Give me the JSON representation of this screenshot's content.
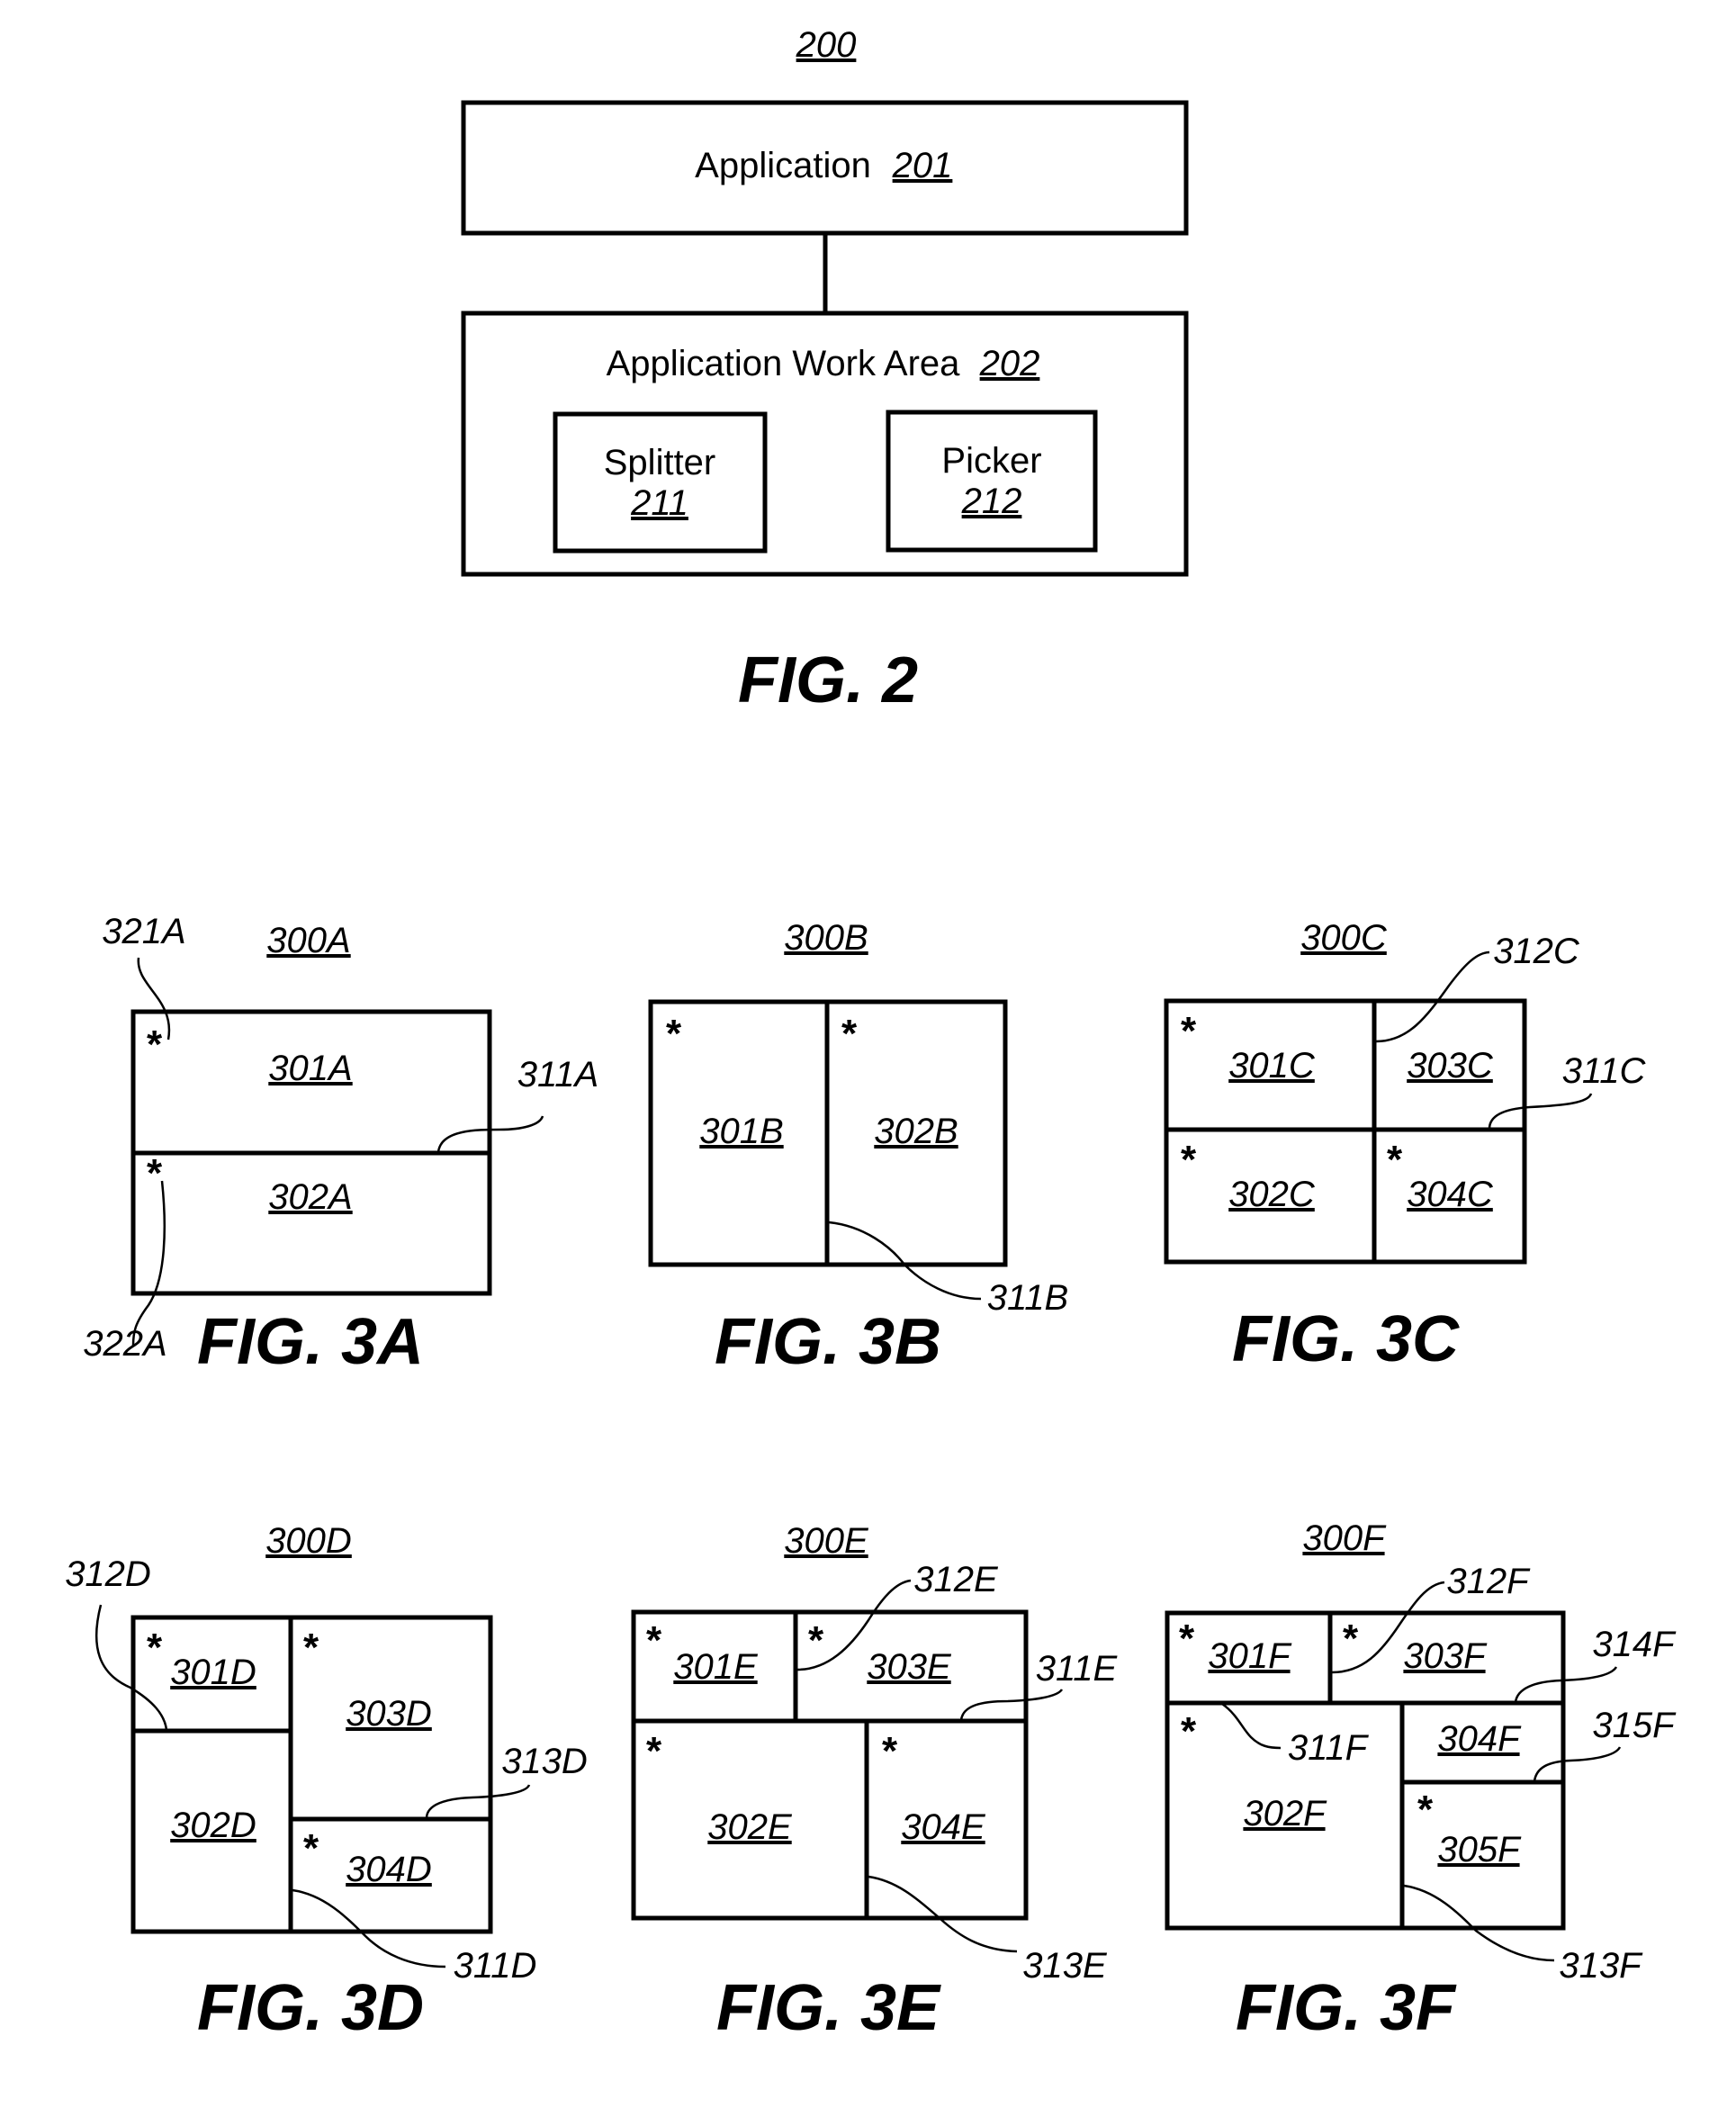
{
  "fig2": {
    "ref": "200",
    "application": {
      "label": "Application",
      "ref": "201"
    },
    "work_area": {
      "label": "Application Work Area",
      "ref": "202"
    },
    "splitter": {
      "label": "Splitter",
      "ref": "211"
    },
    "picker": {
      "label": "Picker",
      "ref": "212"
    },
    "caption": "FIG.  2"
  },
  "fig3a": {
    "ref": "300A",
    "caption": "FIG.  3A",
    "panes": [
      "301A",
      "302A"
    ],
    "splitters": [
      "311A"
    ],
    "markers": [
      "321A",
      "322A"
    ],
    "marker_symbol": "*"
  },
  "fig3b": {
    "ref": "300B",
    "caption": "FIG.  3B",
    "panes": [
      "301B",
      "302B"
    ],
    "splitters": [
      "311B"
    ],
    "marker_symbol": "*"
  },
  "fig3c": {
    "ref": "300C",
    "caption": "FIG.  3C",
    "panes": [
      "301C",
      "302C",
      "303C",
      "304C"
    ],
    "splitters": [
      "311C",
      "312C"
    ],
    "marker_symbol": "*"
  },
  "fig3d": {
    "ref": "300D",
    "caption": "FIG.  3D",
    "panes": [
      "301D",
      "302D",
      "303D",
      "304D"
    ],
    "splitters": [
      "311D",
      "312D",
      "313D"
    ],
    "marker_symbol": "*"
  },
  "fig3e": {
    "ref": "300E",
    "caption": "FIG.  3E",
    "panes": [
      "301E",
      "302E",
      "303E",
      "304E"
    ],
    "splitters": [
      "311E",
      "312E",
      "313E"
    ],
    "marker_symbol": "*"
  },
  "fig3f": {
    "ref": "300F",
    "caption": "FIG.  3F",
    "panes": [
      "301F",
      "302F",
      "303F",
      "304F",
      "305F"
    ],
    "splitters": [
      "311F",
      "312F",
      "313F",
      "314F",
      "315F"
    ],
    "marker_symbol": "*"
  }
}
